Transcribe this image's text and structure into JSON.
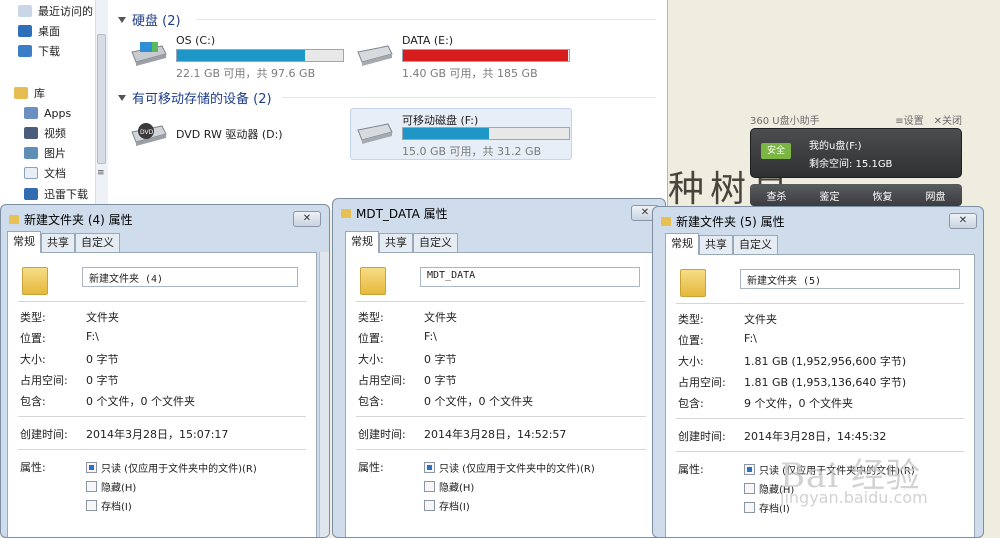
{
  "nav": {
    "items": [
      {
        "label": "最近访问的"
      },
      {
        "label": "桌面"
      },
      {
        "label": "下载"
      },
      {
        "label": "库"
      },
      {
        "label": "Apps"
      },
      {
        "label": "视频"
      },
      {
        "label": "图片"
      },
      {
        "label": "文档"
      },
      {
        "label": "迅雷下载"
      }
    ],
    "scroll_mark": "≡"
  },
  "sections": {
    "hard_disks": "硬盘 (2)",
    "removable": "有可移动存储的设备 (2)"
  },
  "drives": [
    {
      "name": "OS (C:)",
      "info": "22.1 GB 可用，共 97.6 GB",
      "used_fraction": 0.774,
      "color": "#1e96c8"
    },
    {
      "name": "DATA (E:)",
      "info": "1.40 GB 可用，共 185 GB",
      "used_fraction": 0.992,
      "color": "#d61c1c"
    },
    {
      "name": "DVD RW 驱动器 (D:)",
      "info": "",
      "used_fraction": null,
      "color": ""
    },
    {
      "name": "可移动磁盘 (F:)",
      "info": "15.0 GB 可用，共 31.2 GB",
      "used_fraction": 0.52,
      "color": "#1e96c8"
    }
  ],
  "dialogs": [
    {
      "title": "新建文件夹 (4) 属性",
      "tabs": [
        "常规",
        "共享",
        "自定义"
      ],
      "folder_name": "新建文件夹 (4)",
      "rows": [
        {
          "label": "类型:",
          "value": "文件夹"
        },
        {
          "label": "位置:",
          "value": "F:\\"
        },
        {
          "label": "大小:",
          "value": "0 字节"
        },
        {
          "label": "占用空间:",
          "value": "0 字节"
        },
        {
          "label": "包含:",
          "value": "0 个文件，0 个文件夹"
        }
      ],
      "created_label": "创建时间:",
      "created_value": "2014年3月28日，15:07:17",
      "attr_label": "属性:",
      "attrs": [
        "只读 (仅应用于文件夹中的文件)(R)",
        "隐藏(H)",
        "存档(I)"
      ]
    },
    {
      "title": "MDT_DATA 属性",
      "tabs": [
        "常规",
        "共享",
        "自定义"
      ],
      "folder_name": "MDT_DATA",
      "rows": [
        {
          "label": "类型:",
          "value": "文件夹"
        },
        {
          "label": "位置:",
          "value": "F:\\"
        },
        {
          "label": "大小:",
          "value": "0 字节"
        },
        {
          "label": "占用空间:",
          "value": "0 字节"
        },
        {
          "label": "包含:",
          "value": "0 个文件，0 个文件夹"
        }
      ],
      "created_label": "创建时间:",
      "created_value": "2014年3月28日，14:52:57",
      "attr_label": "属性:",
      "attrs": [
        "只读 (仅应用于文件夹中的文件)(R)",
        "隐藏(H)",
        "存档(I)"
      ]
    },
    {
      "title": "新建文件夹 (5) 属性",
      "tabs": [
        "常规",
        "共享",
        "自定义"
      ],
      "folder_name": "新建文件夹 (5)",
      "rows": [
        {
          "label": "类型:",
          "value": "文件夹"
        },
        {
          "label": "位置:",
          "value": "F:\\"
        },
        {
          "label": "大小:",
          "value": "1.81 GB (1,952,956,600 字节)"
        },
        {
          "label": "占用空间:",
          "value": "1.81 GB (1,953,136,640 字节)"
        },
        {
          "label": "包含:",
          "value": "9 个文件，0 个文件夹"
        }
      ],
      "created_label": "创建时间:",
      "created_value": "2014年3月28日，14:45:32",
      "attr_label": "属性:",
      "attrs": [
        "只读 (仅应用于文件夹中的文件)(R)",
        "隐藏(H)",
        "存档(I)"
      ]
    }
  ],
  "u_helper": {
    "title": "360 U盘小助手",
    "settings": "≡设置",
    "close": "✕关闭",
    "badge": "安全",
    "disk_name": "我的u盘(F:)",
    "space": "剩余空间: 15.1GB",
    "actions": [
      "查杀",
      "鉴定",
      "恢复",
      "网盘"
    ]
  },
  "background": {
    "brush_text": "种树易"
  },
  "watermark": {
    "text": "Bai 经验",
    "url": "jingyan.baidu.com"
  }
}
